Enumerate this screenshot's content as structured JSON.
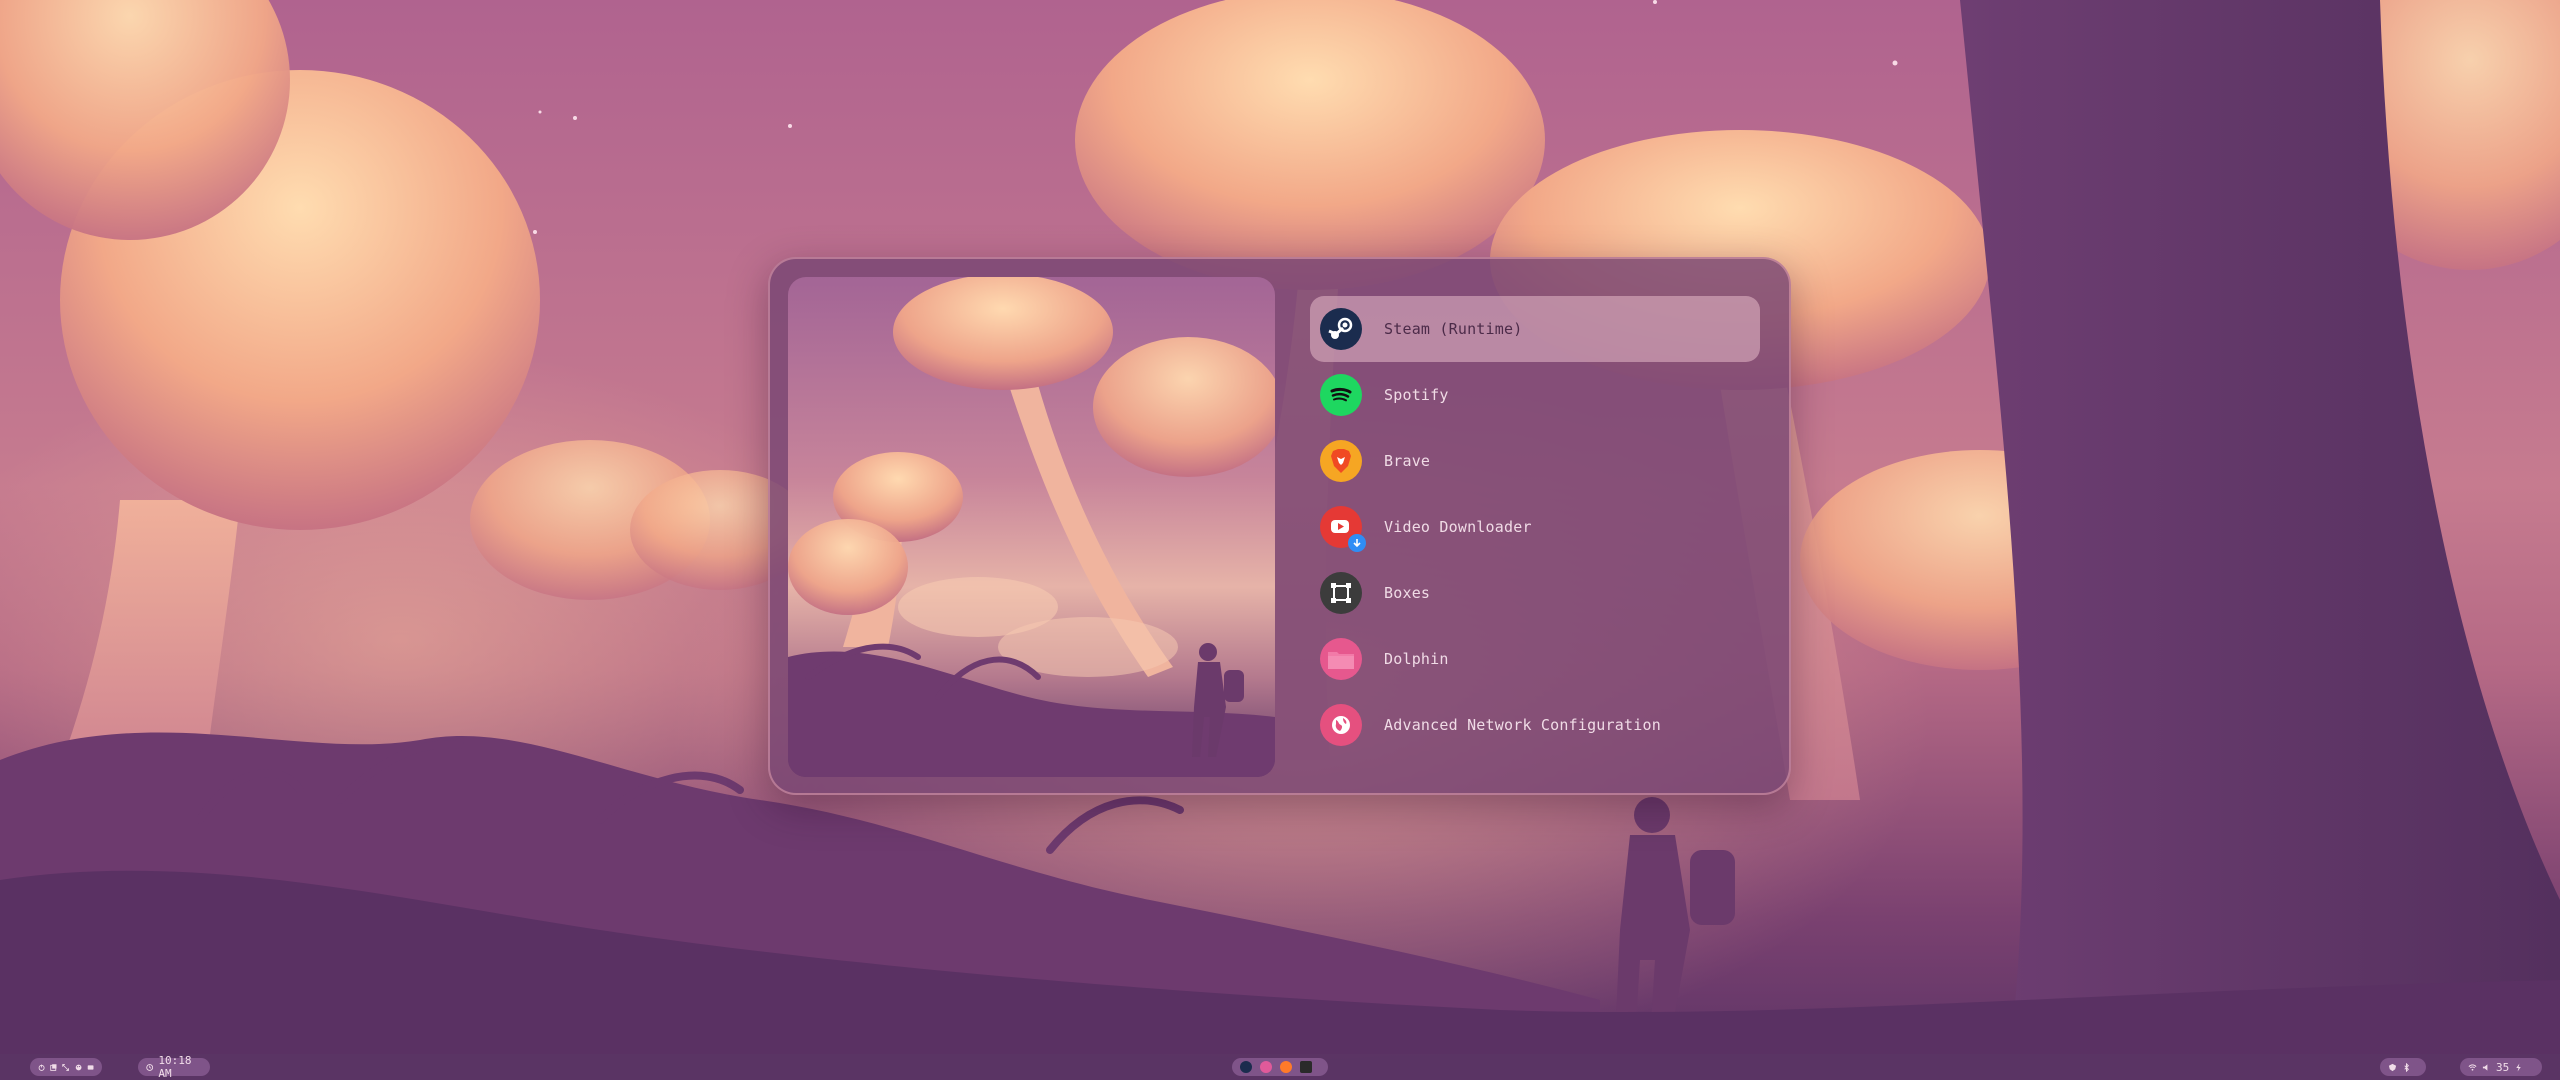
{
  "launcher": {
    "apps": [
      {
        "label": "Steam (Runtime)",
        "icon": "steam-icon",
        "selected": true
      },
      {
        "label": "Spotify",
        "icon": "spotify-icon"
      },
      {
        "label": "Brave",
        "icon": "brave-icon"
      },
      {
        "label": "Video Downloader",
        "icon": "video-downloader-icon"
      },
      {
        "label": "Boxes",
        "icon": "boxes-icon"
      },
      {
        "label": "Dolphin",
        "icon": "dolphin-icon"
      },
      {
        "label": "Advanced Network Configuration",
        "icon": "network-icon"
      }
    ]
  },
  "taskbar": {
    "clock": "10:18 AM",
    "volume": "35",
    "workspace_icons": [
      "power-icon",
      "files-icon",
      "expand-icon",
      "palette-icon",
      "terminal-icon"
    ],
    "dock_apps": [
      "steam-icon",
      "kitty-icon",
      "firefox-icon",
      "terminal-icon"
    ]
  },
  "colors": {
    "accent": "#e9a7bd",
    "panel": "#784673",
    "taskbar": "#5a3464"
  }
}
